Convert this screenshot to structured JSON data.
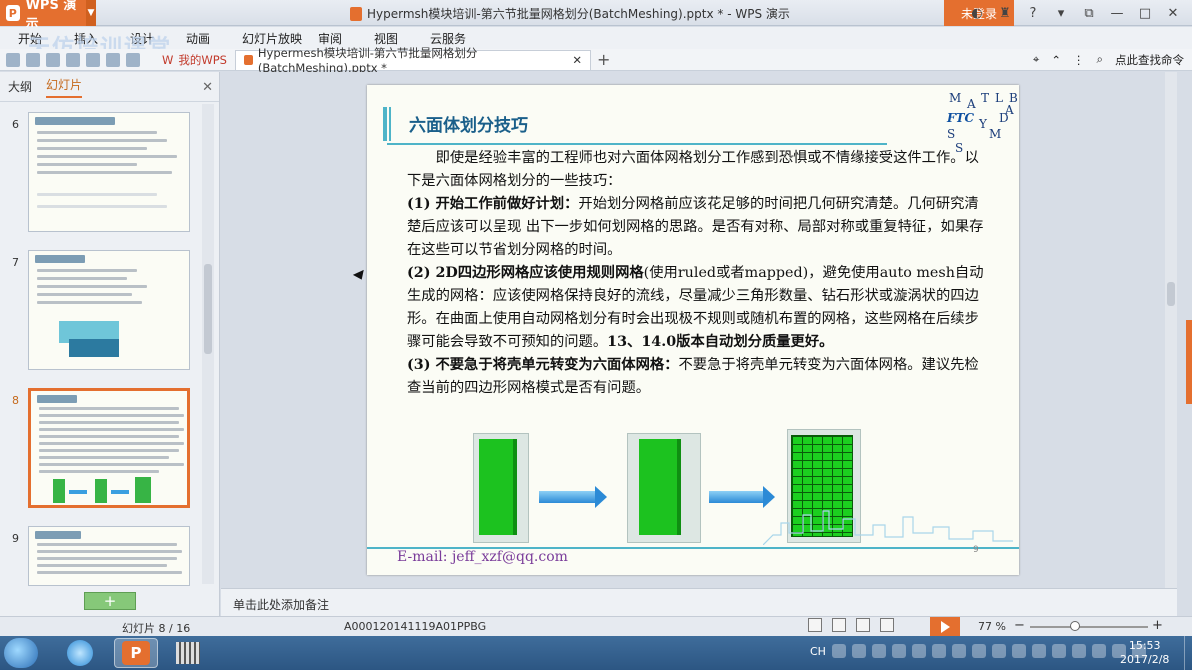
{
  "titlebar": {
    "app_name": "WPS 演示",
    "doc_title": "Hypermsh模块培训-第六节批量网格划分(BatchMeshing).pptx * - WPS 演示",
    "login": "未登录"
  },
  "menu": {
    "items": [
      "开始",
      "插入",
      "设计",
      "动画",
      "幻灯片放映",
      "审阅",
      "视图",
      "云服务"
    ]
  },
  "watermark": "天仿培训课堂",
  "tabs": {
    "home": "我的WPS",
    "doc": "Hypermesh模块培训-第六节批量网格划分(BatchMeshing).pptx *",
    "search": "点此查找命令"
  },
  "leftpanel": {
    "tab_outline": "大纲",
    "tab_slides": "幻灯片",
    "slide_numbers": [
      "6",
      "7",
      "8",
      "9"
    ]
  },
  "slide": {
    "title": "六面体划分技巧",
    "logo_letters": [
      "M",
      "A",
      "T",
      "L",
      "A",
      "B",
      "D",
      "FTC",
      "Y",
      "M",
      "S",
      "S"
    ],
    "intro": "即使是经验丰富的工程师也对六面体网格划分工作感到恐惧或不情缘接受这件工作。以下是六面体网格划分的一些技巧：",
    "p1_head": "(1) 开始工作前做好计划：",
    "p1_body": "开始划分网格前应该花足够的时间把几何研究清楚。几何研究清楚后应该可以呈现 出下一步如何划网格的思路。是否有对称、局部对称或重复特征，如果存在这些可以节省划分网格的时间。",
    "p2_head": "(2) 2D四边形网格应该使用规则网格",
    "p2_body1": "(使用ruled或者mapped)，避免使用auto mesh自动生成的网格：应该使网格保持良好的流线，尽量减少三角形数量、钻石形状或漩涡状的四边形。在曲面上使用自动网格划分有时会出现极不规则或随机布置的网格，这些网格在后续步骤可能会导致不可预知的问题。",
    "p2_body2": "13、14.0版本自动划分质量更好。",
    "p3_head": "(3) 不要急于将壳单元转变为六面体网格：",
    "p3_body": "不要急于将壳单元转变为六面体网格。建议先检查当前的四边形网格模式是否有问题。",
    "email": "E-mail: jeff_xzf@qq.com",
    "page": "9"
  },
  "notes": {
    "placeholder": "单击此处添加备注"
  },
  "status": {
    "slide_indicator": "幻灯片 8 / 16",
    "template_code": "A000120141119A01PPBG",
    "zoom": "77 %"
  },
  "taskbar": {
    "tray_lang": "CH",
    "time": "15:53",
    "date": "2017/2/8"
  },
  "colors": {
    "accent": "#e46f2f",
    "title_blue": "#1a5f8a",
    "mesh_green": "#1cc21f"
  }
}
